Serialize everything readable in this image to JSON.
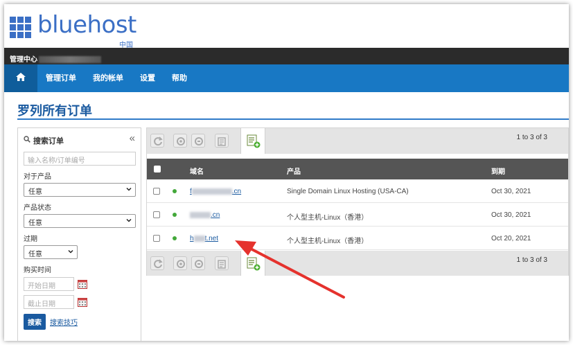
{
  "brand": {
    "name": "bluehost",
    "sub": "中国"
  },
  "admin_bar": {
    "label": "管理中心"
  },
  "nav": {
    "items": [
      "管理订单",
      "我的帐单",
      "设置",
      "帮助"
    ]
  },
  "page": {
    "title": "罗列所有订单"
  },
  "sidebar": {
    "title": "搜索订单",
    "collapse": "«",
    "search_placeholder": "输入名称/订单编号",
    "product_label": "对于产品",
    "product_value": "任意",
    "status_label": "产品状态",
    "status_value": "任意",
    "expire_label": "过期",
    "expire_value": "任意",
    "purchase_label": "购买时间",
    "start_placeholder": "开始日期",
    "end_placeholder": "截止日期",
    "search_button": "搜索",
    "search_tips": "搜索技巧"
  },
  "orders": {
    "paging_top": "1 to 3 of 3",
    "paging_bottom": "1 to 3 of 3",
    "columns": {
      "domain": "域名",
      "product": "产品",
      "expires": "到期"
    },
    "rows": [
      {
        "domain_prefix": "f",
        "domain_suffix": ".cn",
        "product": "Single Domain Linux Hosting (USA-CA)",
        "expires": "Oct 30, 2021"
      },
      {
        "domain_prefix": "",
        "domain_suffix": ".cn",
        "product": "个人型主机-Linux（香港）",
        "expires": "Oct 30, 2021"
      },
      {
        "domain_prefix": "h",
        "domain_suffix": "t.net",
        "product": "个人型主机-Linux（香港）",
        "expires": "Oct 20, 2021"
      }
    ]
  },
  "colors": {
    "brand_blue": "#3b6fc5",
    "nav_blue": "#1878c4",
    "title_blue": "#1a5aa0",
    "status_green": "#43a83a",
    "arrow_red": "#e5322d"
  }
}
